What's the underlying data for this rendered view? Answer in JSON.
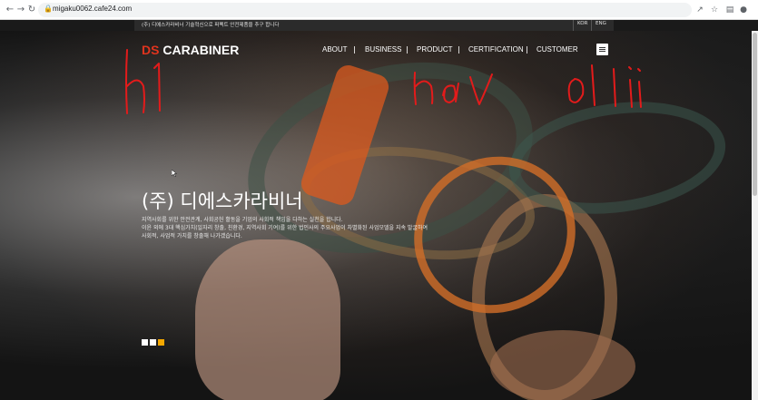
{
  "browser": {
    "url": "migaku0062.cafe24.com",
    "back_icon": "arrow-left",
    "forward_icon": "arrow-right",
    "reload_icon": "reload"
  },
  "topbar": {
    "notice": "(주) 디에스카라비너 기술혁신으로 퍼펙트 안전제품을 추구 합니다",
    "lang_kor": "KOR",
    "lang_eng": "ENG"
  },
  "header": {
    "logo_prefix": "DS",
    "logo_name": "CARABINER",
    "nav": [
      "ABOUT",
      "BUSINESS",
      "PRODUCT",
      "CERTIFICATION",
      "CUSTOMER"
    ]
  },
  "hero": {
    "title": "(주) 디에스카라비너",
    "desc_line1": "지역사회를 위한 안전관계, 사회공헌 활동을 기업의 사회적 책임을 다하는 실천을 합니다.",
    "desc_line2": "이윤 외에 3대 핵심가치(일자리 창출, 친환경, 지역사회 기여)를 위한 법인사의 주요사업이 차별화된 사업모델을 지속 발굴하여",
    "desc_line3": "사회적, 사업적 가치를 창출해 나가겠습니다.",
    "slides": [
      {
        "color": "#ffffff",
        "active": false
      },
      {
        "color": "#ffffff",
        "active": false
      },
      {
        "color": "#f5a800",
        "active": true
      }
    ]
  },
  "annotations": [
    "h1",
    "nav",
    "ol li"
  ],
  "colors": {
    "brand_red": "#e0341e",
    "annotation_red": "#e31b1b",
    "slide_active": "#f5a800"
  }
}
